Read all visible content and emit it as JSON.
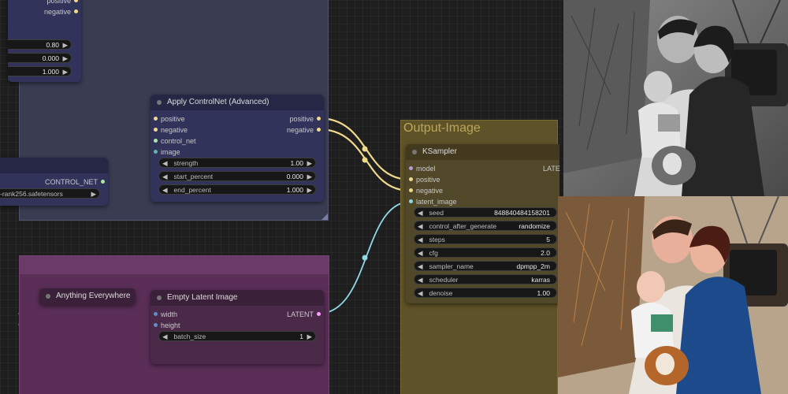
{
  "top_left_node": {
    "outputs": [
      "positive",
      "negative"
    ],
    "values": [
      "0.80",
      "0.000",
      "1.000"
    ]
  },
  "controlnet_loader": {
    "output_label": "CONTROL_NET",
    "model_value": "-rank256.safetensors"
  },
  "apply_controlnet": {
    "title": "Apply ControlNet (Advanced)",
    "inputs": [
      "positive",
      "negative",
      "control_net",
      "image"
    ],
    "outputs": [
      "positive",
      "negative"
    ],
    "widgets": [
      {
        "label": "strength",
        "value": "1.00"
      },
      {
        "label": "start_percent",
        "value": "0.000"
      },
      {
        "label": "end_percent",
        "value": "1.000"
      }
    ]
  },
  "anything_everywhere": {
    "title": "Anything Everywhere"
  },
  "empty_latent": {
    "title": "Empty Latent Image",
    "inputs": [
      "width",
      "height"
    ],
    "output": "LATENT",
    "widgets": [
      {
        "label": "batch_size",
        "value": "1"
      }
    ]
  },
  "output_group": {
    "title": "Output-Image"
  },
  "ksampler": {
    "title": "KSampler",
    "inputs": [
      "model",
      "positive",
      "negative",
      "latent_image"
    ],
    "output": "LATE",
    "widgets": [
      {
        "label": "seed",
        "value": "848840484158201"
      },
      {
        "label": "control_after_generate",
        "value": "randomize"
      },
      {
        "label": "steps",
        "value": "5"
      },
      {
        "label": "cfg",
        "value": "2.0"
      },
      {
        "label": "sampler_name",
        "value": "dpmpp_2m"
      },
      {
        "label": "scheduler",
        "value": "karras"
      },
      {
        "label": "denoise",
        "value": "1.00"
      }
    ]
  },
  "colors": {
    "conditioning": "#f0d98a",
    "controlnet": "#a8e8a0",
    "latent": "#ff9cf9",
    "latent_wire": "#90d8e6",
    "int_wire": "#3a78b8",
    "model": "#b39ddb",
    "image": "#64b5a6"
  }
}
